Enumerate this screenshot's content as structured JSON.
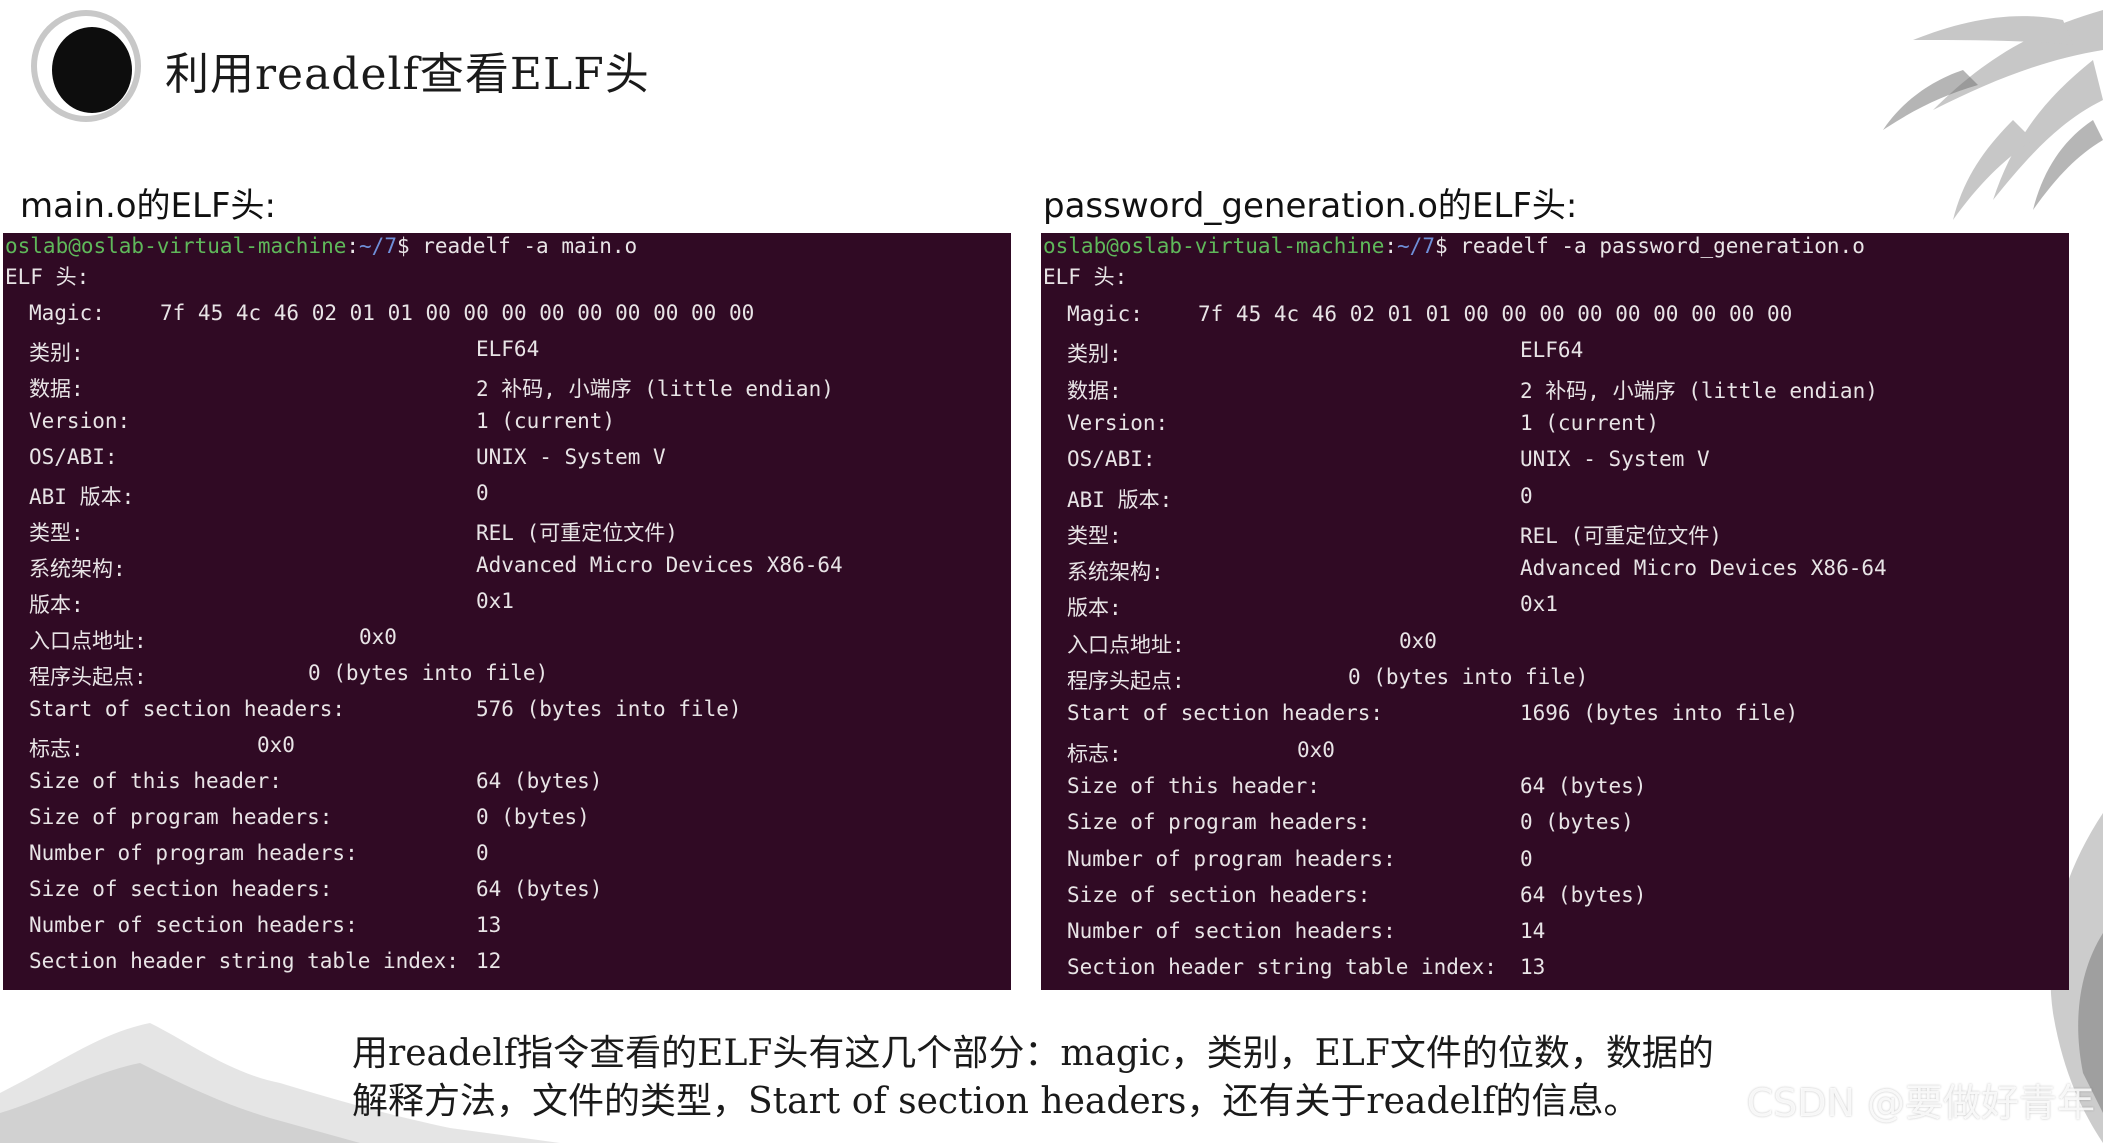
{
  "slide": {
    "title": "利用readelf查看ELF头"
  },
  "panels": [
    {
      "caption": "main.o的ELF头:",
      "prompt_user": "oslab@oslab-virtual-machine",
      "prompt_sep": ":",
      "prompt_path": "~/7",
      "prompt_cmd": "$ readelf -a main.o",
      "header_line": "ELF 头:",
      "rows": [
        {
          "label": "Magic:",
          "value": "7f 45 4c 46 02 01 01 00 00 00 00 00 00 00 00 00"
        },
        {
          "label": "类别:",
          "value": "ELF64"
        },
        {
          "label": "数据:",
          "value": "2 补码, 小端序 (little endian)"
        },
        {
          "label": "Version:",
          "value": "1 (current)"
        },
        {
          "label": "OS/ABI:",
          "value": "UNIX - System V"
        },
        {
          "label": "ABI 版本:",
          "value": "0"
        },
        {
          "label": "类型:",
          "value": "REL (可重定位文件)"
        },
        {
          "label": "系统架构:",
          "value": "Advanced Micro Devices X86-64"
        },
        {
          "label": "版本:",
          "value": "0x1"
        },
        {
          "label": "入口点地址:",
          "value": "0x0"
        },
        {
          "label": "程序头起点:",
          "value": "0 (bytes into file)"
        },
        {
          "label": "Start of section headers:",
          "value": "576 (bytes into file)"
        },
        {
          "label": "标志:",
          "value": "0x0"
        },
        {
          "label": "Size of this header:",
          "value": "64 (bytes)"
        },
        {
          "label": "Size of program headers:",
          "value": "0 (bytes)"
        },
        {
          "label": "Number of program headers:",
          "value": "0"
        },
        {
          "label": "Size of section headers:",
          "value": "64 (bytes)"
        },
        {
          "label": "Number of section headers:",
          "value": "13"
        },
        {
          "label": "Section header string table index:",
          "value": "12"
        }
      ]
    },
    {
      "caption": "password_generation.o的ELF头:",
      "prompt_user": "oslab@oslab-virtual-machine",
      "prompt_sep": ":",
      "prompt_path": "~/7",
      "prompt_cmd": "$ readelf -a password_generation.o",
      "header_line": "ELF 头:",
      "rows": [
        {
          "label": "Magic:",
          "value": "7f 45 4c 46 02 01 01 00 00 00 00 00 00 00 00 00"
        },
        {
          "label": "类别:",
          "value": "ELF64"
        },
        {
          "label": "数据:",
          "value": "2 补码, 小端序 (little endian)"
        },
        {
          "label": "Version:",
          "value": "1 (current)"
        },
        {
          "label": "OS/ABI:",
          "value": "UNIX - System V"
        },
        {
          "label": "ABI 版本:",
          "value": "0"
        },
        {
          "label": "类型:",
          "value": "REL (可重定位文件)"
        },
        {
          "label": "系统架构:",
          "value": "Advanced Micro Devices X86-64"
        },
        {
          "label": "版本:",
          "value": "0x1"
        },
        {
          "label": "入口点地址:",
          "value": "0x0"
        },
        {
          "label": "程序头起点:",
          "value": "0 (bytes into file)"
        },
        {
          "label": "Start of section headers:",
          "value": "1696 (bytes into file)"
        },
        {
          "label": "标志:",
          "value": "0x0"
        },
        {
          "label": "Size of this header:",
          "value": "64 (bytes)"
        },
        {
          "label": "Size of program headers:",
          "value": "0 (bytes)"
        },
        {
          "label": "Number of program headers:",
          "value": "0"
        },
        {
          "label": "Size of section headers:",
          "value": "64 (bytes)"
        },
        {
          "label": "Number of section headers:",
          "value": "14"
        },
        {
          "label": "Section header string table index:",
          "value": "13"
        }
      ]
    }
  ],
  "summary": {
    "line1": "用readelf指令查看的ELF头有这几个部分：magic，类别，ELF文件的位数，数据的",
    "line2": "解释方法，文件的类型，Start of section headers，还有关于readelf的信息。"
  },
  "watermark": "CSDN @要做好青年",
  "colors": {
    "terminal_bg": "#300a24",
    "terminal_text": "#e8e4e6",
    "prompt_user": "#5fb85a",
    "prompt_path": "#6f8fd8"
  }
}
